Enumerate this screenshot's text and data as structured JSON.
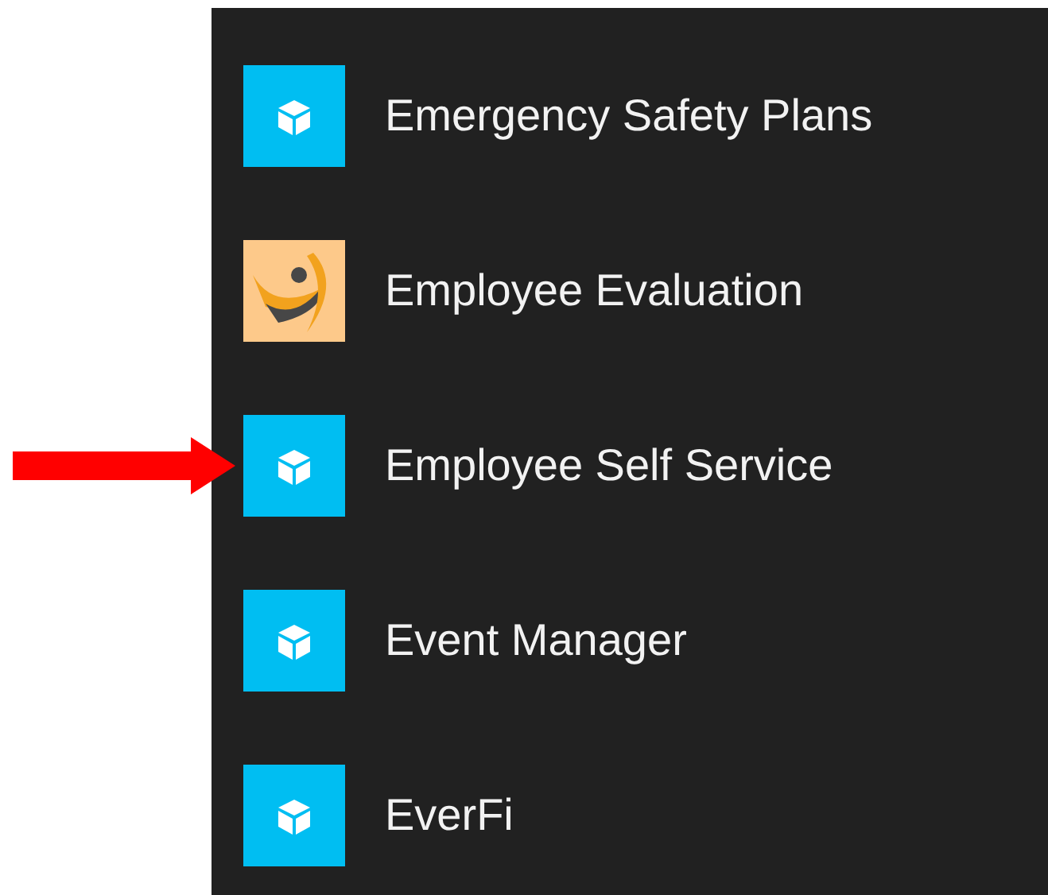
{
  "apps": [
    {
      "label": "Emergency Safety Plans",
      "kind": "cube",
      "pointed": false
    },
    {
      "label": "Employee Evaluation",
      "kind": "logo",
      "pointed": false
    },
    {
      "label": "Employee Self Service",
      "kind": "cube",
      "pointed": true
    },
    {
      "label": "Event Manager",
      "kind": "cube",
      "pointed": false
    },
    {
      "label": "EverFi",
      "kind": "cube",
      "pointed": false
    }
  ]
}
